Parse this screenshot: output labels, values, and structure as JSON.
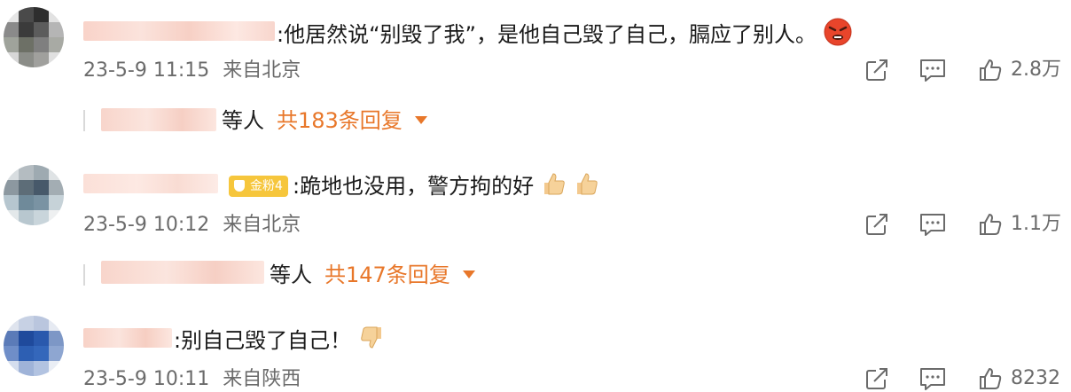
{
  "comments": [
    {
      "text": ":他居然说“别毁了我”，是他自己毁了自己，膈应了别人。",
      "time": "23-5-9 11:15",
      "location": "来自北京",
      "likes": "2.8万",
      "reply_suffix": "等人",
      "reply_count": "共183条回复",
      "emoji": "angry-face-icon"
    },
    {
      "badge": "金粉4",
      "text": ":跪地也没用，警方拘的好",
      "time": "23-5-9 10:12",
      "location": "来自北京",
      "likes": "1.1万",
      "reply_suffix": "等人",
      "reply_count": "共147条回复",
      "emoji": "thumbs-up-icon"
    },
    {
      "text": ":别自己毁了自己！",
      "time": "23-5-9 10:11",
      "location": "来自陕西",
      "likes": "8232",
      "emoji": "thumbs-down-icon"
    }
  ]
}
